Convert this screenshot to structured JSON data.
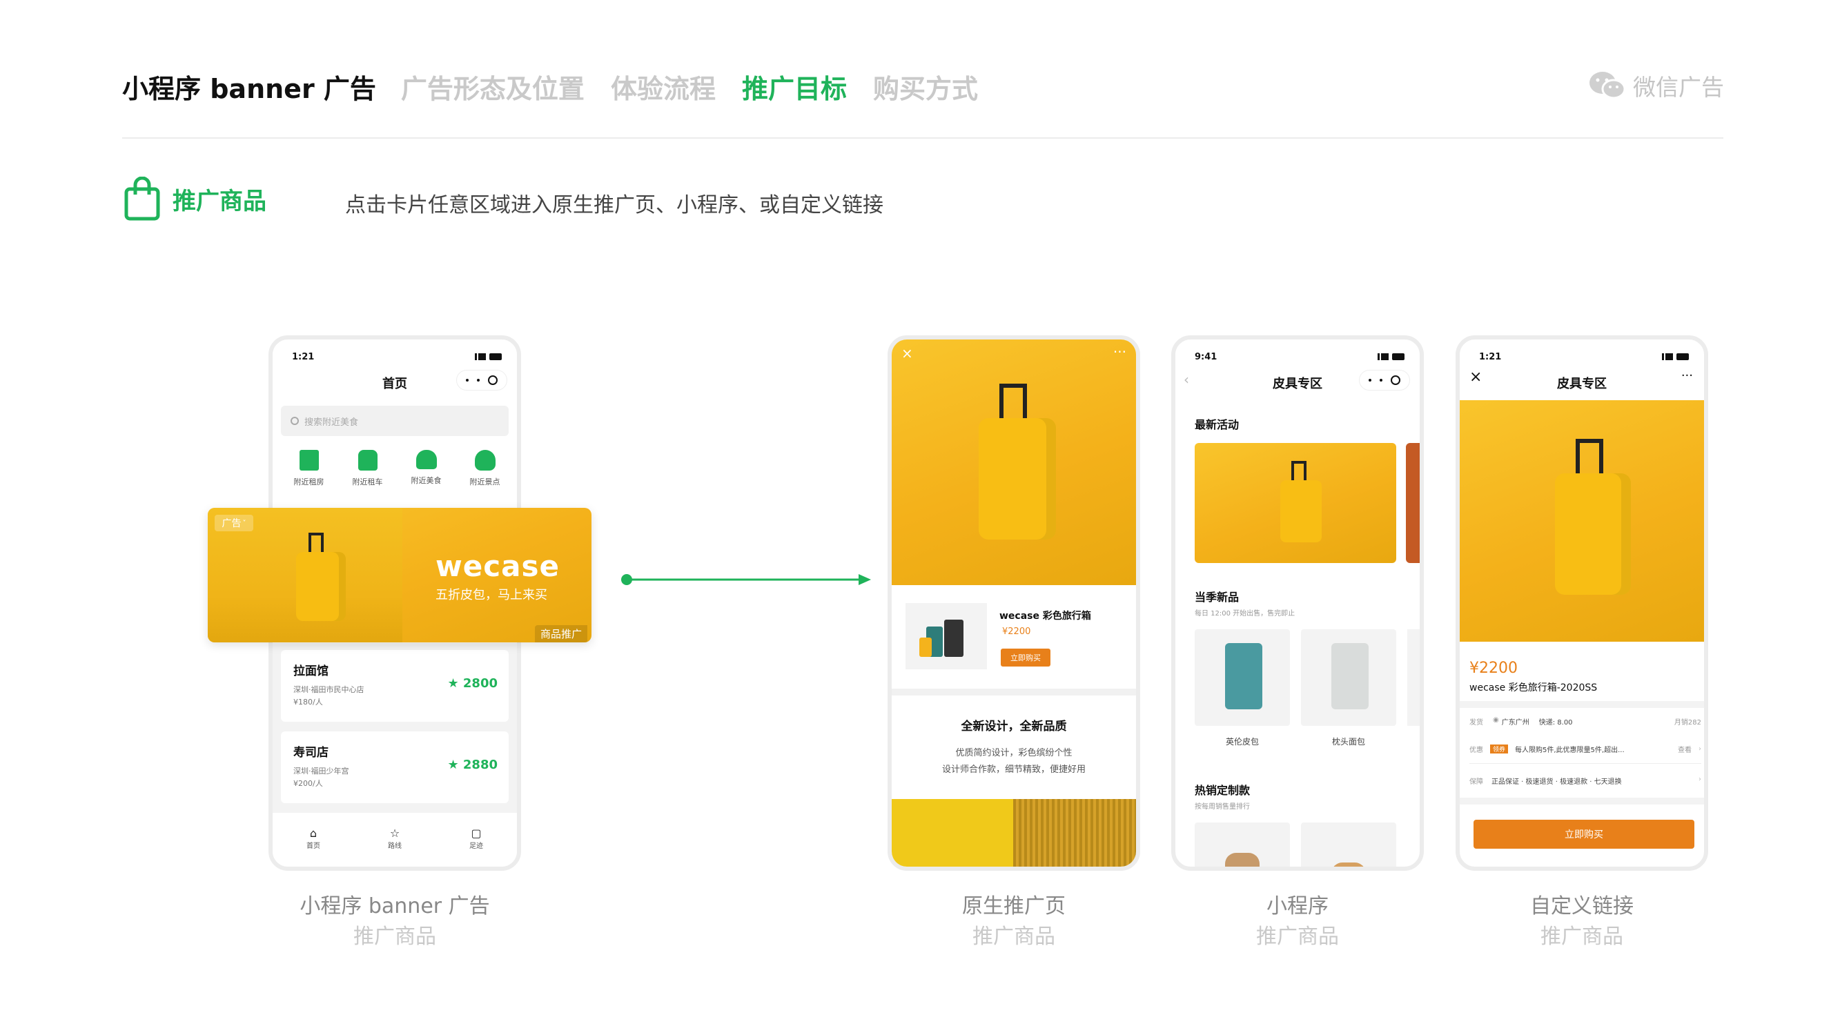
{
  "header": {
    "tabs": [
      {
        "label": "小程序 banner 广告"
      },
      {
        "label": "广告形态及位置"
      },
      {
        "label": "体验流程"
      },
      {
        "label": "推广目标"
      },
      {
        "label": "购买方式"
      }
    ],
    "brand": "微信广告"
  },
  "section": {
    "title": "推广商品",
    "desc": "点击卡片任意区域进入原生推广页、小程序、或自定义链接"
  },
  "colors": {
    "accent": "#1fb35a",
    "orange": "#e8801a",
    "yellow": "#f6b91f"
  },
  "phone1": {
    "time": "1:21",
    "title": "首页",
    "search_placeholder": "搜索附近美食",
    "icons": [
      {
        "label": "附近租房",
        "icon": "building-icon"
      },
      {
        "label": "附近租车",
        "icon": "bus-icon"
      },
      {
        "label": "附近美食",
        "icon": "burger-icon"
      },
      {
        "label": "附近景点",
        "icon": "tree-icon"
      }
    ],
    "ad_tag": "广告",
    "ad_brand": "wecase",
    "ad_slogan": "五折皮包，马上来买",
    "ad_badge": "商品推广",
    "stores": [
      {
        "name": "拉面馆",
        "addr": "深圳·福田市民中心店",
        "price": "¥180/人",
        "score": "2800"
      },
      {
        "name": "寿司店",
        "addr": "深圳·福田少年宫",
        "price": "¥200/人",
        "score": "2880"
      }
    ],
    "tabbar": [
      {
        "label": "首页",
        "icon": "home-icon"
      },
      {
        "label": "路线",
        "icon": "star-icon"
      },
      {
        "label": "足迹",
        "icon": "footprint-icon"
      }
    ]
  },
  "phone2": {
    "product_name": "wecase 彩色旅行箱",
    "price": "¥2200",
    "buy": "立即购买",
    "headline": "全新设计，全新品质",
    "body1": "优质简约设计，彩色缤纷个性",
    "body2": "设计师合作款，细节精致，便捷好用"
  },
  "phone3": {
    "time": "9:41",
    "title": "皮具专区",
    "section1": "最新活动",
    "section2": "当季新品",
    "section2_sub": "每日 12:00 开始出售，售完即止",
    "items": [
      {
        "label": "英伦皮包"
      },
      {
        "label": "枕头面包"
      }
    ],
    "section3": "热销定制款",
    "section3_sub": "按每周销售量排行"
  },
  "phone4": {
    "time": "1:21",
    "title": "皮具专区",
    "price": "¥2200",
    "product_name": "wecase 彩色旅行箱-2020SS",
    "ship_label": "发货",
    "ship_value": "广东广州",
    "express": "快递: 8.00",
    "sold": "月销282",
    "promo_label": "优惠",
    "promo_tag": "领券",
    "promo_text": "每人限购5件,此优惠限量5件,超出...",
    "promo_more": "查看",
    "guarantee_label": "保障",
    "guarantee_text": "正品保证 · 极速退货 · 极速退款 · 七天退换",
    "buy": "立即购买"
  },
  "captions": [
    {
      "title": "小程序 banner 广告",
      "sub": "推广商品"
    },
    {
      "title": "原生推广页",
      "sub": "推广商品"
    },
    {
      "title": "小程序",
      "sub": "推广商品"
    },
    {
      "title": "自定义链接",
      "sub": "推广商品"
    }
  ]
}
